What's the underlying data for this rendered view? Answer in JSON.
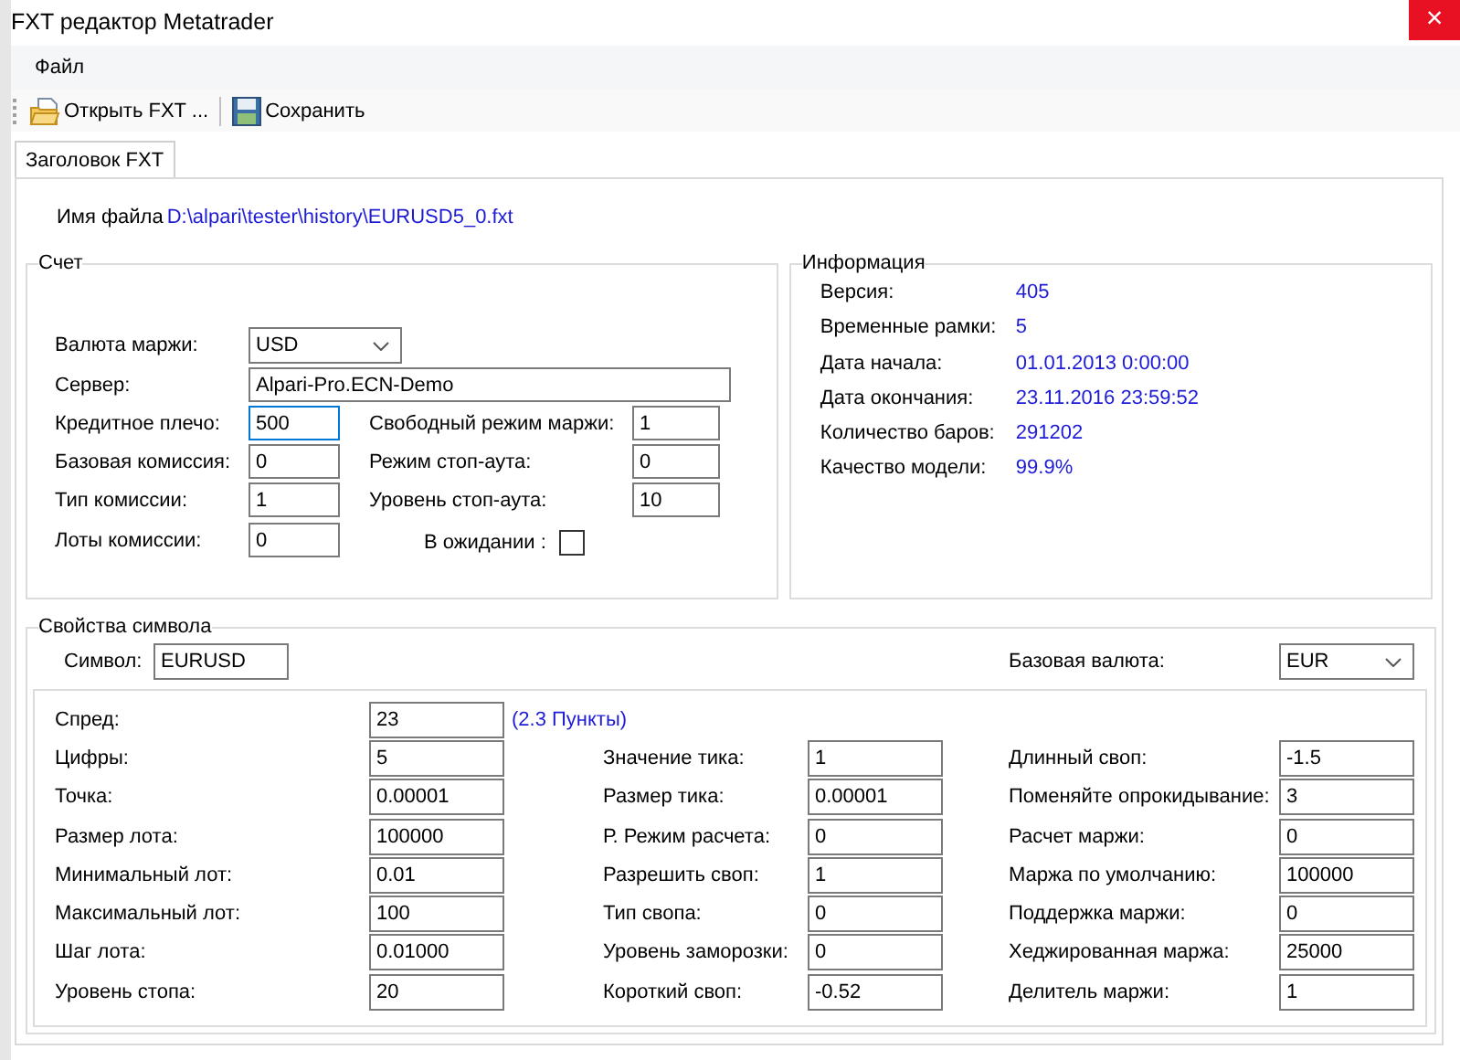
{
  "window": {
    "title": "FXT редактор Metatrader",
    "close": "×"
  },
  "menu": [
    {
      "label": "Файл"
    }
  ],
  "toolbar": [
    {
      "kind": "open",
      "label": "Открыть FXT ..."
    },
    {
      "kind": "save",
      "label": "Сохранить"
    }
  ],
  "tabs": [
    {
      "label": "Заголовок FXT",
      "selected": true
    }
  ],
  "file": {
    "label": "Имя файла",
    "path": "D:\\alpari\\tester\\history\\EURUSD5_0.fxt"
  },
  "account": {
    "title": "Счет",
    "currency": {
      "label": "Валюта маржи:",
      "value": "USD"
    },
    "server": {
      "label": "Сервер:",
      "value": "Alpari-Pro.ECN-Demo"
    },
    "left_fields": [
      {
        "label": "Кредитное плечо:",
        "value": "500",
        "focused": true
      },
      {
        "label": "Базовая комиссия:",
        "value": "0",
        "focused": false
      },
      {
        "label": "Тип комиссии:",
        "value": "1",
        "focused": false
      },
      {
        "label": "Лоты комиссии:",
        "value": "0",
        "focused": false
      }
    ],
    "right_fields": [
      {
        "label": "Свободный режим маржи:",
        "value": "1",
        "focused": false
      },
      {
        "label": "Режим стоп-аута:",
        "value": "0",
        "focused": false
      },
      {
        "label": "Уровень стоп-аута:",
        "value": "10",
        "focused": false
      }
    ],
    "pending": {
      "label": "В ожидании :",
      "checked": false
    }
  },
  "info": {
    "title": "Информация",
    "items": [
      {
        "label": "Версия:",
        "value": "405"
      },
      {
        "label": "Временные рамки:",
        "value": "5"
      },
      {
        "label": "Дата начала:",
        "value": "01.01.2013 0:00:00"
      },
      {
        "label": "Дата окончания:",
        "value": "23.11.2016 23:59:52"
      },
      {
        "label": "Количество баров:",
        "value": "291202"
      },
      {
        "label": "Качество модели:",
        "value": "99.9%"
      }
    ]
  },
  "symbol": {
    "title": "Свойства символа",
    "symbol": {
      "label": "Символ:",
      "value": "EURUSD"
    },
    "base_currency": {
      "label": "Базовая валюта:",
      "value": "EUR"
    },
    "spread": {
      "label": "Спред:",
      "value": "23",
      "note": "(2.3 Пункты)"
    },
    "rows": [
      [
        {
          "label": "Цифры:",
          "value": "5"
        },
        {
          "label": "Значение тика:",
          "value": "1"
        },
        {
          "label": "Длинный своп:",
          "value": "-1.5"
        }
      ],
      [
        {
          "label": "Точка:",
          "value": "0.00001"
        },
        {
          "label": "Размер тика:",
          "value": "0.00001"
        },
        {
          "label": "Поменяйте опрокидывание:",
          "value": "3"
        }
      ],
      [
        {
          "label": "Размер лота:",
          "value": "100000"
        },
        {
          "label": "Р. Режим расчета:",
          "value": "0"
        },
        {
          "label": "Расчет маржи:",
          "value": "0"
        }
      ],
      [
        {
          "label": "Минимальный лот:",
          "value": "0.01"
        },
        {
          "label": "Разрешить своп:",
          "value": "1"
        },
        {
          "label": "Маржа по умолчанию:",
          "value": "100000"
        }
      ],
      [
        {
          "label": "Максимальный лот:",
          "value": "100"
        },
        {
          "label": "Тип свопа:",
          "value": "0"
        },
        {
          "label": "Поддержка маржи:",
          "value": "0"
        }
      ],
      [
        {
          "label": "Шаг лота:",
          "value": "0.01000"
        },
        {
          "label": "Уровень заморозки:",
          "value": "0"
        },
        {
          "label": "Хеджированная маржа:",
          "value": "25000"
        }
      ],
      [
        {
          "label": "Уровень стопа:",
          "value": "20"
        },
        {
          "label": "Короткий своп:",
          "value": "-0.52"
        },
        {
          "label": "Делитель маржи:",
          "value": "1"
        }
      ]
    ]
  }
}
